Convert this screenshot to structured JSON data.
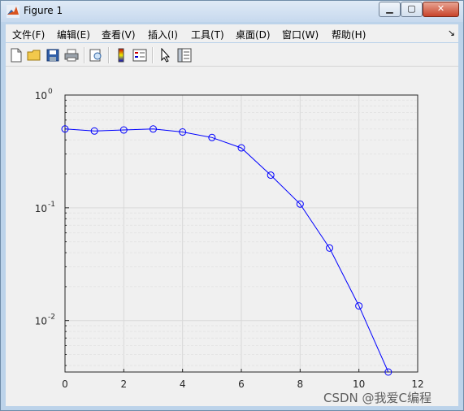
{
  "window": {
    "title": "Figure 1"
  },
  "menu": [
    "文件(F)",
    "编辑(E)",
    "查看(V)",
    "插入(I)",
    "工具(T)",
    "桌面(D)",
    "窗口(W)",
    "帮助(H)"
  ],
  "toolbar": {
    "icons": [
      "new-figure-icon",
      "open-file-icon",
      "save-icon",
      "print-icon",
      "print-preview-icon",
      "colorbar-icon",
      "legend-icon",
      "pointer-icon",
      "property-editor-icon"
    ]
  },
  "watermark": "CSDN @我爱C编程",
  "chart_data": {
    "type": "line",
    "title": "",
    "xlabel": "",
    "ylabel": "",
    "yscale": "log",
    "xlim": [
      0,
      12
    ],
    "ylim": [
      0.0035,
      1
    ],
    "grid": true,
    "marker": "circle",
    "line_color": "#0000ff",
    "x_ticks": [
      "0",
      "2",
      "4",
      "6",
      "8",
      "10",
      "12"
    ],
    "x_tick_values": [
      0,
      2,
      4,
      6,
      8,
      10,
      12
    ],
    "y_ticks": [
      {
        "base": "10",
        "exp": "0",
        "value": 1
      },
      {
        "base": "10",
        "exp": "-1",
        "value": 0.1
      },
      {
        "base": "10",
        "exp": "-2",
        "value": 0.01
      }
    ],
    "series": [
      {
        "x": [
          0,
          1,
          2,
          3,
          4,
          5,
          6,
          7,
          8,
          9,
          10,
          11
        ],
        "values": [
          0.5,
          0.48,
          0.49,
          0.5,
          0.47,
          0.42,
          0.34,
          0.195,
          0.108,
          0.044,
          0.0135,
          0.0035
        ]
      }
    ]
  }
}
